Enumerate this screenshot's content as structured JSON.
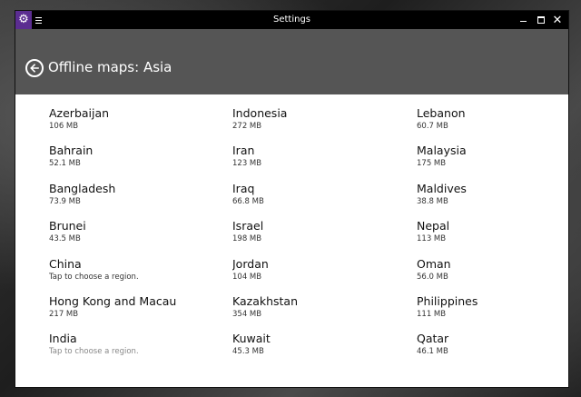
{
  "window": {
    "title": "Settings",
    "app_icon": "gear-icon",
    "menu_icon": "hamburger-icon"
  },
  "header": {
    "title": "Offline maps: Asia",
    "back_icon": "back-arrow-icon",
    "background_color": "#555555"
  },
  "regions": {
    "column1": [
      {
        "name": "Azerbaijan",
        "detail": "106 MB"
      },
      {
        "name": "Bahrain",
        "detail": "52.1 MB"
      },
      {
        "name": "Bangladesh",
        "detail": "73.9 MB"
      },
      {
        "name": "Brunei",
        "detail": "43.5 MB"
      },
      {
        "name": "China",
        "detail": "Tap to choose a region."
      },
      {
        "name": "Hong Kong and Macau",
        "detail": "217 MB"
      },
      {
        "name": "India",
        "detail": "Tap to choose a region."
      }
    ],
    "column2": [
      {
        "name": "Indonesia",
        "detail": "272 MB"
      },
      {
        "name": "Iran",
        "detail": "123 MB"
      },
      {
        "name": "Iraq",
        "detail": "66.8 MB"
      },
      {
        "name": "Israel",
        "detail": "198 MB"
      },
      {
        "name": "Jordan",
        "detail": "104 MB"
      },
      {
        "name": "Kazakhstan",
        "detail": "354 MB"
      },
      {
        "name": "Kuwait",
        "detail": "45.3 MB"
      }
    ],
    "column3": [
      {
        "name": "Lebanon",
        "detail": "60.7 MB"
      },
      {
        "name": "Malaysia",
        "detail": "175 MB"
      },
      {
        "name": "Maldives",
        "detail": "38.8 MB"
      },
      {
        "name": "Nepal",
        "detail": "113 MB"
      },
      {
        "name": "Oman",
        "detail": "56.0 MB"
      },
      {
        "name": "Philippines",
        "detail": "111 MB"
      },
      {
        "name": "Qatar",
        "detail": "46.1 MB"
      }
    ]
  }
}
